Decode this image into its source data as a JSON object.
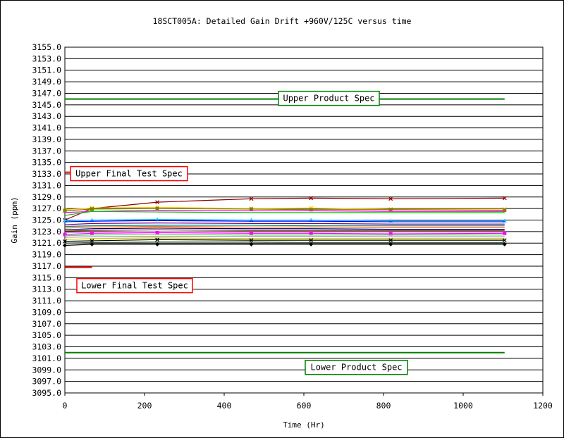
{
  "chart_data": {
    "type": "line",
    "title": "18SCT005A: Detailed Gain Drift +960V/125C versus time",
    "xlabel": "Time (Hr)",
    "ylabel": "Gain (ppm)",
    "xlim": [
      0,
      1200
    ],
    "ylim": [
      3095,
      3155
    ],
    "xticks": [
      0,
      200,
      400,
      600,
      800,
      1000,
      1200
    ],
    "yticks": [
      3095,
      3097,
      3099,
      3101,
      3103,
      3105,
      3107,
      3109,
      3111,
      3113,
      3115,
      3117,
      3119,
      3121,
      3123,
      3125,
      3127,
      3129,
      3131,
      3133,
      3135,
      3137,
      3139,
      3141,
      3143,
      3145,
      3147,
      3149,
      3151,
      3153,
      3155
    ],
    "grid": "horizontal",
    "x": [
      0,
      68,
      232,
      468,
      618,
      818,
      1104
    ],
    "spec_lines": [
      {
        "label": "Upper Product Spec",
        "y": 3146,
        "x": [
          0,
          1104
        ],
        "color": "#008000"
      },
      {
        "label": "Lower Product Spec",
        "y": 3102,
        "x": [
          0,
          1104
        ],
        "color": "#008000"
      },
      {
        "label": "Upper Final Test Spec",
        "y": 3133.3,
        "x": [
          0,
          68
        ],
        "color": "#ff0000"
      },
      {
        "label": "Lower Final Test Spec",
        "y": 3116.8,
        "x": [
          0,
          68
        ],
        "color": "#ff0000"
      }
    ],
    "series": [
      {
        "values": [
          3125.0,
          3127.0,
          3128.1,
          3128.7,
          3128.8,
          3128.7,
          3128.8
        ],
        "color": "#8b0000",
        "marker": "x"
      },
      {
        "values": [
          3126.8,
          3127.1,
          3127.2,
          3127.0,
          3127.1,
          3126.9,
          3126.9
        ],
        "color": "#ffcc00",
        "marker": "x"
      },
      {
        "values": [
          3126.6,
          3126.9,
          3127.0,
          3126.9,
          3126.8,
          3126.8,
          3126.7
        ],
        "color": "#808000",
        "marker": "square"
      },
      {
        "values": [
          3126.3,
          3126.5,
          3126.7,
          3126.6,
          3126.6,
          3126.5,
          3126.5
        ],
        "color": "#ff00ff",
        "marker": "none"
      },
      {
        "values": [
          3125.8,
          3126.5,
          3126.4,
          3126.3,
          3126.3,
          3126.3,
          3126.3
        ],
        "color": "#00cc00",
        "marker": "none"
      },
      {
        "values": [
          3124.9,
          3125.0,
          3125.1,
          3125.0,
          3125.0,
          3124.9,
          3124.9
        ],
        "color": "#00ccff",
        "marker": "triangle"
      },
      {
        "values": [
          3124.7,
          3124.8,
          3124.9,
          3124.8,
          3124.8,
          3124.7,
          3124.7
        ],
        "color": "#0000ff",
        "marker": "none"
      },
      {
        "values": [
          3124.2,
          3124.4,
          3124.5,
          3124.4,
          3124.4,
          3124.3,
          3124.3
        ],
        "color": "#800080",
        "marker": "none"
      },
      {
        "values": [
          3123.9,
          3124.0,
          3124.1,
          3124.1,
          3124.0,
          3124.0,
          3124.0
        ],
        "color": "#008080",
        "marker": "none"
      },
      {
        "values": [
          3123.6,
          3123.8,
          3123.9,
          3123.8,
          3123.8,
          3123.7,
          3123.7
        ],
        "color": "#ff6600",
        "marker": "none"
      },
      {
        "values": [
          3123.3,
          3123.5,
          3123.6,
          3123.5,
          3123.5,
          3123.4,
          3123.4
        ],
        "color": "#000080",
        "marker": "none"
      },
      {
        "values": [
          3123.1,
          3123.2,
          3123.3,
          3123.2,
          3123.2,
          3123.2,
          3123.2
        ],
        "color": "#993300",
        "marker": "none"
      },
      {
        "values": [
          3122.8,
          3122.9,
          3123.0,
          3122.9,
          3122.9,
          3122.9,
          3122.9
        ],
        "color": "#cc99ff",
        "marker": "none"
      },
      {
        "values": [
          3122.5,
          3122.7,
          3122.8,
          3122.7,
          3122.7,
          3122.6,
          3122.7
        ],
        "color": "#ff00ff",
        "marker": "square"
      },
      {
        "values": [
          3122.3,
          3122.4,
          3122.5,
          3122.4,
          3122.4,
          3122.4,
          3122.4
        ],
        "color": "#66cc66",
        "marker": "none"
      },
      {
        "values": [
          3122.0,
          3122.1,
          3122.2,
          3122.2,
          3122.2,
          3122.1,
          3122.1
        ],
        "color": "#999999",
        "marker": "none"
      },
      {
        "values": [
          3121.6,
          3121.8,
          3121.9,
          3121.8,
          3121.8,
          3121.8,
          3121.8
        ],
        "color": "#cccc00",
        "marker": "none"
      },
      {
        "values": [
          3121.3,
          3121.4,
          3121.6,
          3121.5,
          3121.5,
          3121.5,
          3121.5
        ],
        "color": "#000000",
        "marker": "x"
      },
      {
        "values": [
          3121.0,
          3121.1,
          3121.2,
          3121.2,
          3121.1,
          3121.1,
          3121.1
        ],
        "color": "#336633",
        "marker": "none"
      },
      {
        "values": [
          3120.6,
          3120.8,
          3120.8,
          3120.8,
          3120.8,
          3120.8,
          3120.8
        ],
        "color": "#000000",
        "marker": "diamond"
      }
    ]
  }
}
